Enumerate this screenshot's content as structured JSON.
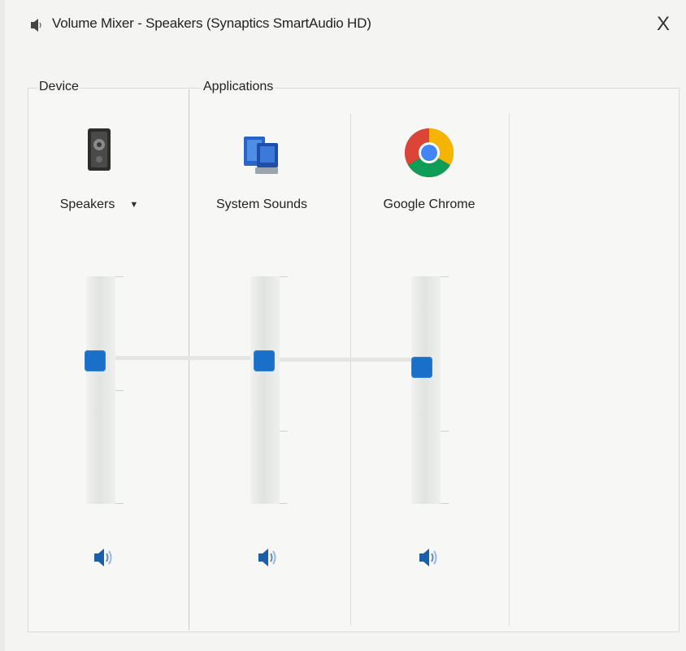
{
  "window": {
    "title": "Volume Mixer - Speakers (Synaptics SmartAudio HD)",
    "close_label": "X"
  },
  "groups": {
    "device_label": "Device",
    "applications_label": "Applications"
  },
  "device": {
    "name": "Speakers",
    "icon": "speaker-icon",
    "volume_level": 0.63,
    "muted": false
  },
  "applications": [
    {
      "name": "System Sounds",
      "icon": "system-sounds-icon",
      "volume_level": 0.63,
      "muted": false
    },
    {
      "name": "Google Chrome",
      "icon": "chrome-icon",
      "volume_level": 0.6,
      "muted": false
    }
  ],
  "colors": {
    "accent": "#1a6fc8",
    "mute_icon": "#1b5fa8"
  }
}
